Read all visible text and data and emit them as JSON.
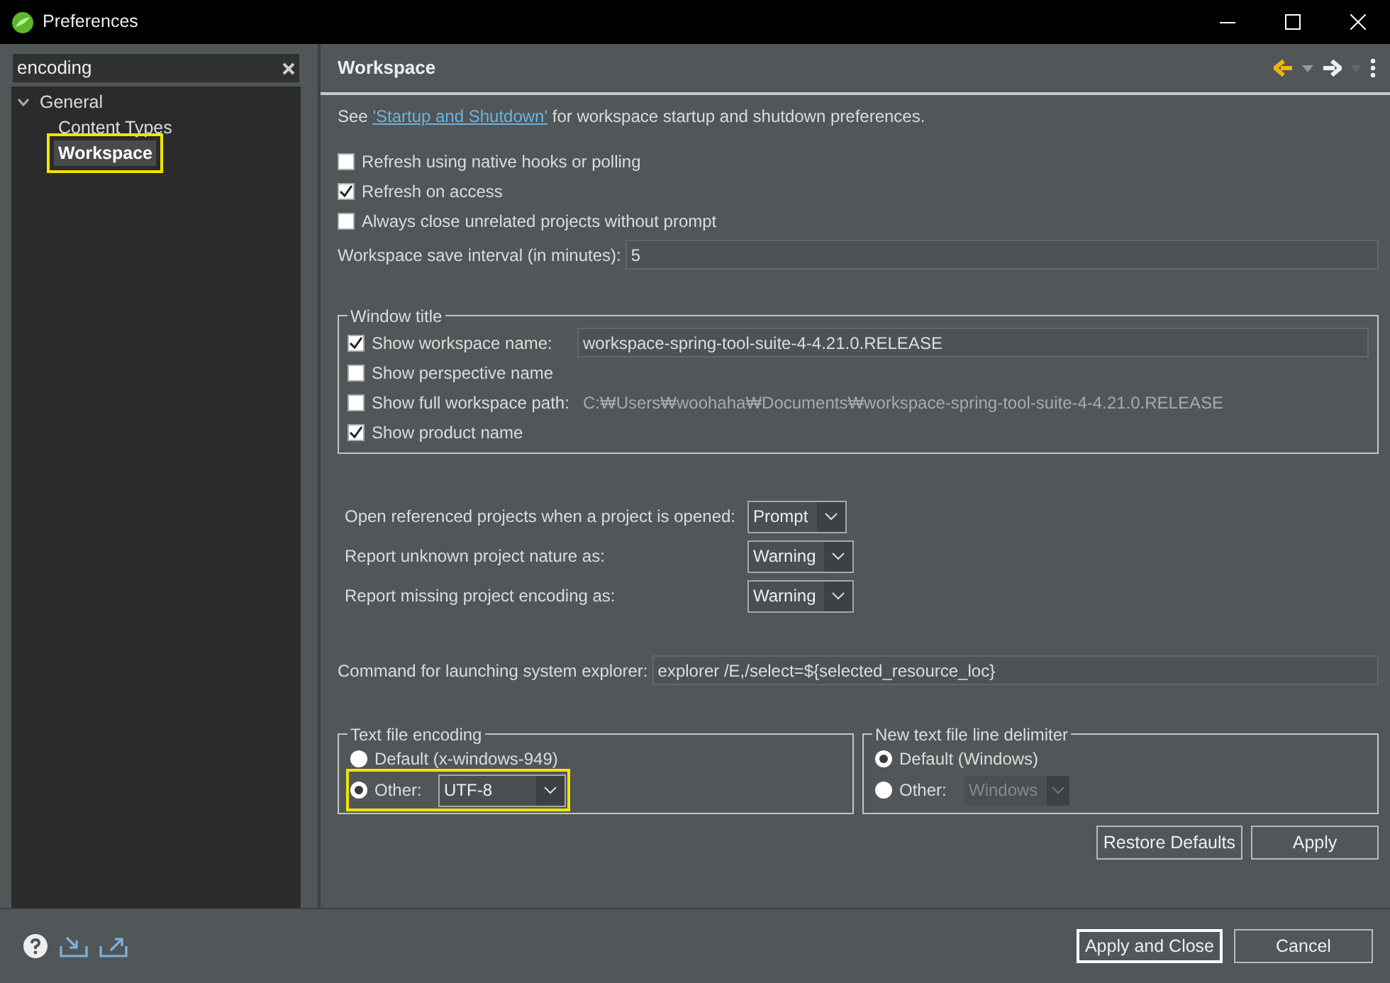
{
  "window": {
    "title": "Preferences"
  },
  "filter": {
    "value": "encoding"
  },
  "tree": [
    {
      "label": "General",
      "expanded": true,
      "selected": false,
      "highlighted": false,
      "children": [
        {
          "label": "Content Types",
          "selected": false,
          "highlighted": false
        },
        {
          "label": "Workspace",
          "selected": true,
          "highlighted": true
        }
      ]
    }
  ],
  "page": {
    "title": "Workspace",
    "intro": {
      "before": "See ",
      "link": "'Startup and Shutdown'",
      "after": " for workspace startup and shutdown preferences."
    },
    "options": [
      {
        "label": "Refresh using native hooks or polling",
        "checked": false
      },
      {
        "label": "Refresh on access",
        "checked": true
      },
      {
        "label": "Always close unrelated projects without prompt",
        "checked": false
      }
    ],
    "save_interval": {
      "label": "Workspace save interval (in minutes):",
      "value": "5"
    },
    "window_title": {
      "legend": "Window title",
      "rows": [
        {
          "label": "Show workspace name:",
          "checked": true,
          "kind": "field",
          "value": "workspace-spring-tool-suite-4-4.21.0.RELEASE"
        },
        {
          "label": "Show perspective name",
          "checked": false,
          "kind": "plain"
        },
        {
          "label": "Show full workspace path:",
          "checked": false,
          "kind": "path",
          "value": "C:₩Users₩woohaha₩Documents₩workspace-spring-tool-suite-4-4.21.0.RELEASE"
        },
        {
          "label": "Show product name",
          "checked": true,
          "kind": "plain"
        }
      ]
    },
    "combos": [
      {
        "label": "Open referenced projects when a project is opened:",
        "value": "Prompt"
      },
      {
        "label": "Report unknown project nature as:",
        "value": "Warning"
      },
      {
        "label": "Report missing project encoding as:",
        "value": "Warning"
      }
    ],
    "explorer": {
      "label": "Command for launching system explorer:",
      "value": "explorer /E,/select=${selected_resource_loc}"
    },
    "encoding": {
      "legend": "Text file encoding",
      "default_label": "Default (x-windows-949)",
      "default_selected": false,
      "other_label": "Other:",
      "other_selected": true,
      "other_value": "UTF-8",
      "other_disabled": false,
      "highlighted": true
    },
    "delimiter": {
      "legend": "New text file line delimiter",
      "default_label": "Default (Windows)",
      "default_selected": true,
      "other_label": "Other:",
      "other_selected": false,
      "other_value": "Windows",
      "other_disabled": true
    },
    "buttons": [
      "Restore Defaults",
      "Apply"
    ]
  },
  "footer_buttons": [
    {
      "label": "Apply and Close",
      "default": true
    },
    {
      "label": "Cancel",
      "default": false
    }
  ]
}
